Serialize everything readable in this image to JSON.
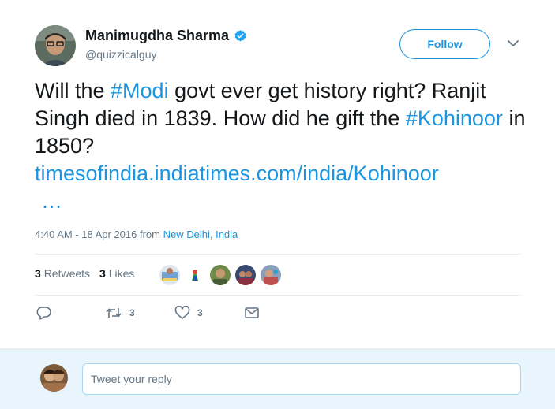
{
  "author": {
    "name": "Manimugdha Sharma",
    "handle": "@quizzicalguy",
    "avatar_icon": "user-avatar"
  },
  "follow_label": "Follow",
  "tweet": {
    "part1": "Will the ",
    "hashtag1": "#Modi",
    "part2": " govt ever get history right? Ranjit Singh died in 1839. How did he gift the ",
    "hashtag2": "#Kohinoor",
    "part3": " in 1850?",
    "link": "timesofindia.indiatimes.com/india/Kohinoor",
    "ellipsis": "…"
  },
  "meta": {
    "timestamp": "4:40 AM - 18 Apr 2016",
    "from_word": " from ",
    "place_city": "New Delhi",
    "place_sep": ", ",
    "place_country": "India"
  },
  "stats": {
    "retweets_count": "3",
    "retweets_label": "Retweets",
    "likes_count": "3",
    "likes_label": "Likes"
  },
  "actions": {
    "retweet_count": "3",
    "like_count": "3"
  },
  "reply": {
    "placeholder": "Tweet your reply"
  },
  "colors": {
    "accent": "#1b95e0",
    "muted": "#657786",
    "reply_bg": "#e8f5fd"
  }
}
